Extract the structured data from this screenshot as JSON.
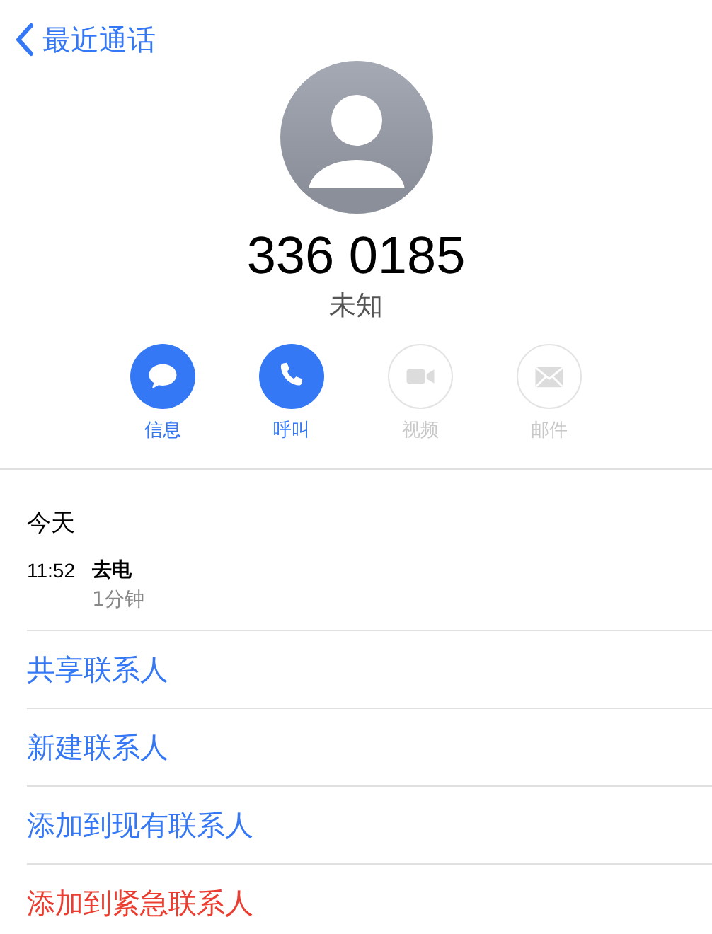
{
  "nav": {
    "back_label": "最近通话"
  },
  "contact": {
    "number": "336 0185",
    "subtitle": "未知"
  },
  "quick_actions": [
    {
      "kind": "message",
      "label": "信息",
      "disabled": false
    },
    {
      "kind": "call",
      "label": "呼叫",
      "disabled": false
    },
    {
      "kind": "video",
      "label": "视频",
      "disabled": true
    },
    {
      "kind": "mail",
      "label": "邮件",
      "disabled": true
    }
  ],
  "call_history": {
    "date": "今天",
    "entries": [
      {
        "time": "11:52",
        "type": "去电",
        "duration": "1分钟"
      }
    ]
  },
  "actions": [
    {
      "label": "共享联系人",
      "kind": "normal"
    },
    {
      "label": "新建联系人",
      "kind": "normal"
    },
    {
      "label": "添加到现有联系人",
      "kind": "normal"
    },
    {
      "label": "添加到紧急联系人",
      "kind": "destructive"
    }
  ]
}
